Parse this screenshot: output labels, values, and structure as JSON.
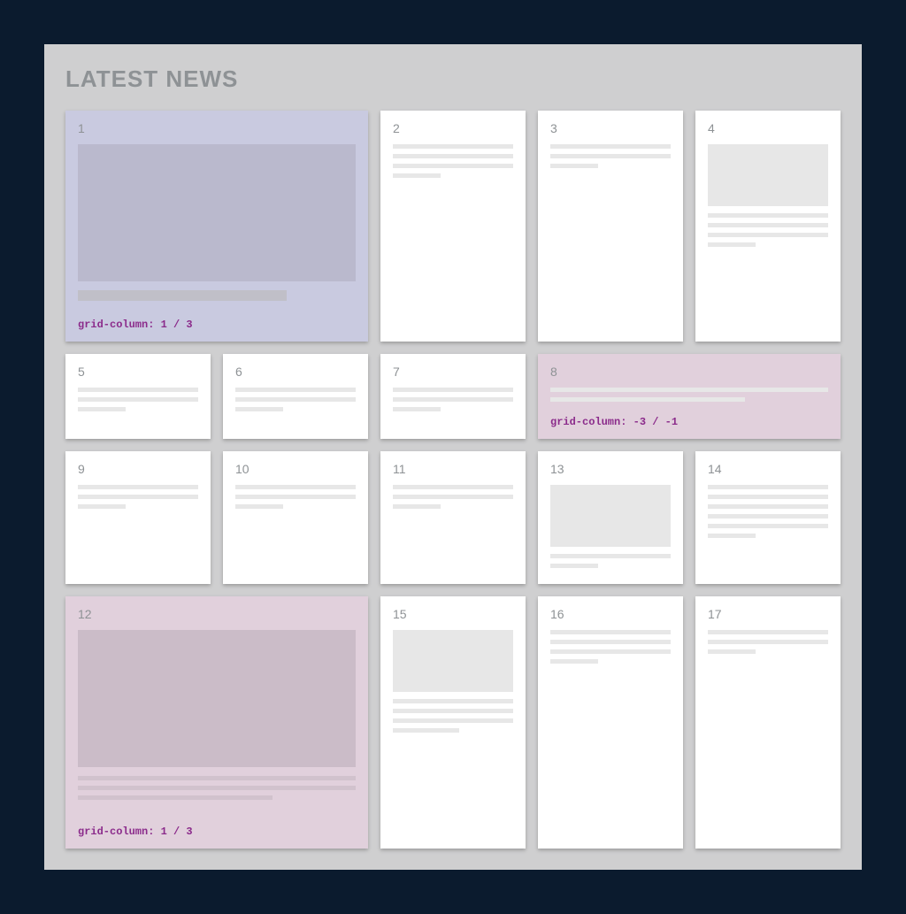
{
  "title": "LATEST NEWS",
  "cards": {
    "c1": {
      "num": "1",
      "code": "grid-column: 1 / 3"
    },
    "c2": {
      "num": "2"
    },
    "c3": {
      "num": "3"
    },
    "c4": {
      "num": "4"
    },
    "c5": {
      "num": "5"
    },
    "c6": {
      "num": "6"
    },
    "c7": {
      "num": "7"
    },
    "c8": {
      "num": "8",
      "code": "grid-column: -3 / -1"
    },
    "c9": {
      "num": "9"
    },
    "c10": {
      "num": "10"
    },
    "c11": {
      "num": "11"
    },
    "c12": {
      "num": "12",
      "code": "grid-column: 1 / 3"
    },
    "c13": {
      "num": "13"
    },
    "c14": {
      "num": "14"
    },
    "c15": {
      "num": "15"
    },
    "c16": {
      "num": "16"
    },
    "c17": {
      "num": "17"
    }
  }
}
